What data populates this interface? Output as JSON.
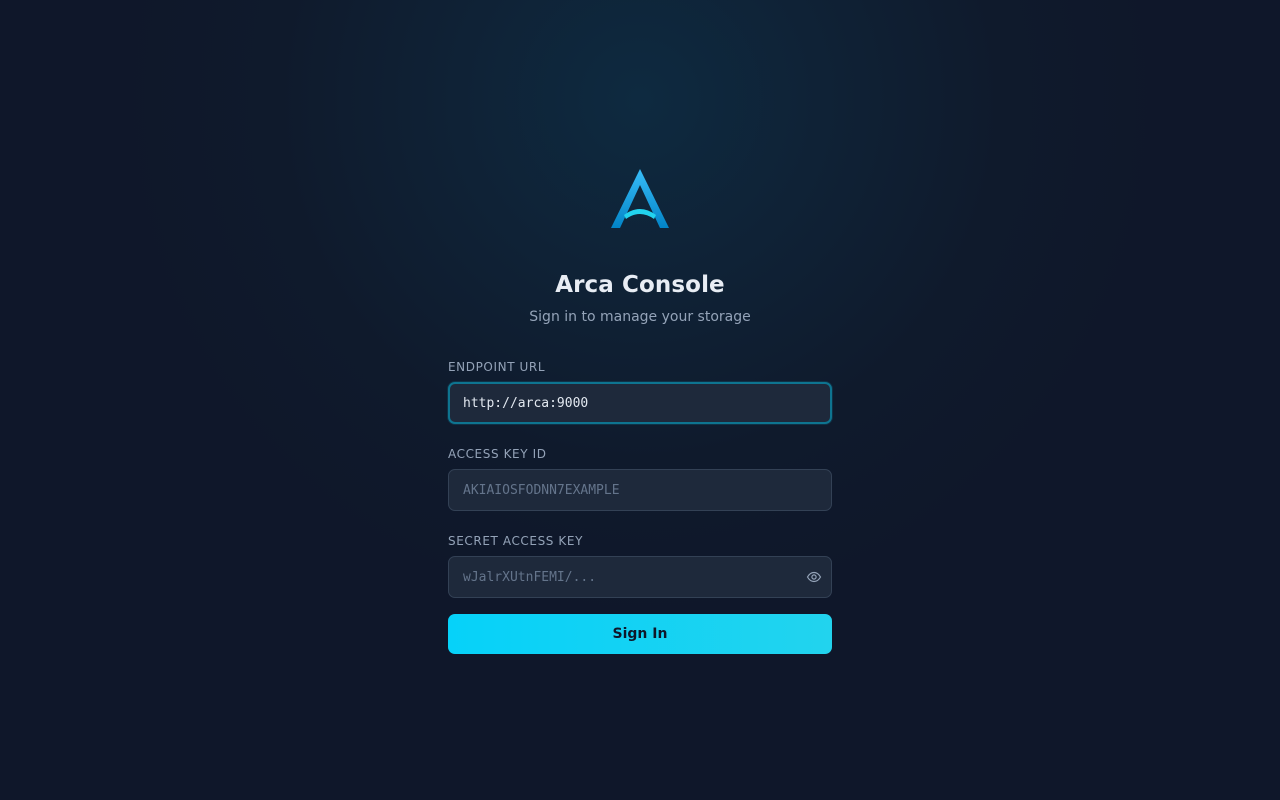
{
  "brand": {
    "logo_icon": "arca-a-logo-icon",
    "accent_color": "#22d3ee",
    "title": "Arca Console",
    "subtitle": "Sign in to manage your storage"
  },
  "form": {
    "endpoint": {
      "label": "ENDPOINT URL",
      "value": "http://arca:9000",
      "placeholder": ""
    },
    "access_key": {
      "label": "ACCESS KEY ID",
      "value": "",
      "placeholder": "AKIAIOSFODNN7EXAMPLE"
    },
    "secret_key": {
      "label": "SECRET ACCESS KEY",
      "value": "",
      "placeholder": "wJalrXUtnFEMI/...",
      "toggle_icon": "eye-icon"
    },
    "submit_label": "Sign In"
  }
}
